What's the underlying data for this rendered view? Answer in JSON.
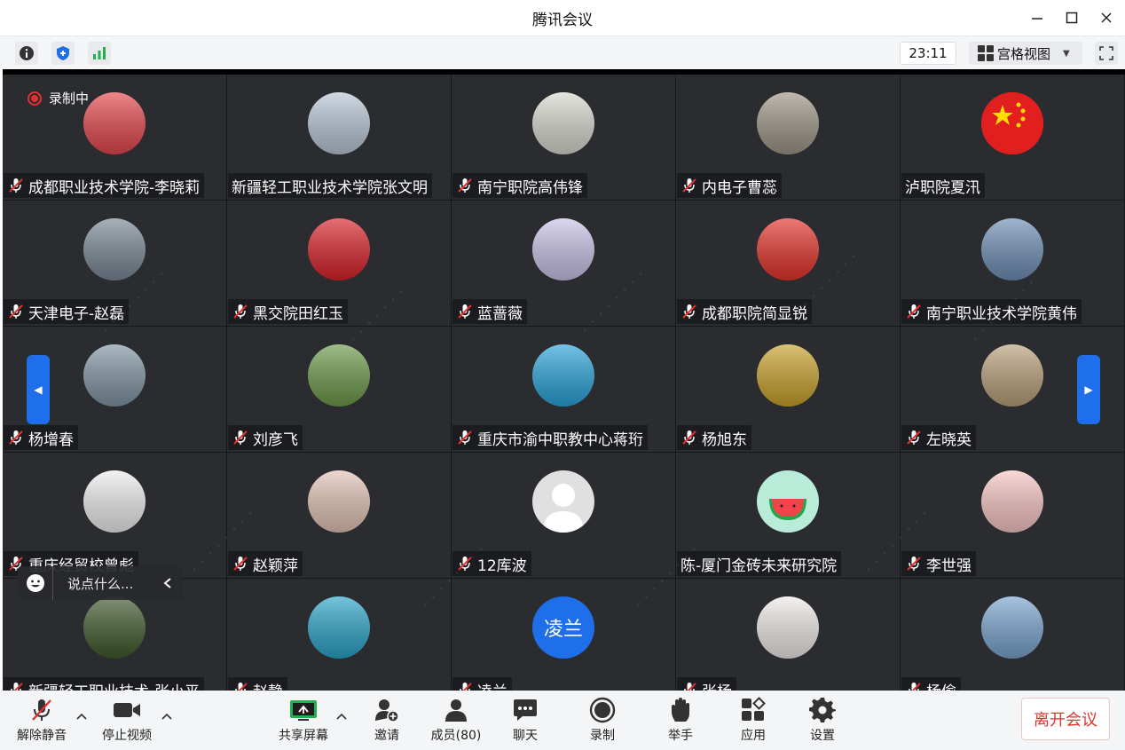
{
  "window": {
    "title": "腾讯会议"
  },
  "toolbar": {
    "timer": "23:11",
    "view_label": "宫格视图"
  },
  "recording": {
    "label": "录制中"
  },
  "chat": {
    "placeholder": "说点什么..."
  },
  "participants": [
    {
      "name": "成都职业技术学院-李晓莉",
      "muted": true,
      "avatar": "rose",
      "color": "#e4474d"
    },
    {
      "name": "新疆轻工职业技术学院张文明",
      "muted": false,
      "avatar": "snow-person",
      "color": "#b9c6d6"
    },
    {
      "name": "南宁职院高伟锋",
      "muted": true,
      "avatar": "cartoon-man",
      "color": "#d8d8d0"
    },
    {
      "name": "内电子曹蕊",
      "muted": true,
      "avatar": "woman-photo",
      "color": "#9e9588"
    },
    {
      "name": "泸职院夏汛",
      "muted": false,
      "avatar": "china-flag",
      "color": "#e21f1f"
    },
    {
      "name": "天津电子-赵磊",
      "muted": true,
      "avatar": "cars",
      "color": "#7b8895"
    },
    {
      "name": "黑交院田红玉",
      "muted": true,
      "avatar": "man-suit-red",
      "color": "#d9232b"
    },
    {
      "name": "蓝蔷薇",
      "muted": true,
      "avatar": "winter-trees",
      "color": "#c9c3e8"
    },
    {
      "name": "成都职院简显锐",
      "muted": true,
      "avatar": "cartoon-flag",
      "color": "#e5342b"
    },
    {
      "name": "南宁职业技术学院黄伟",
      "muted": true,
      "avatar": "tree-sky",
      "color": "#6e8fb5"
    },
    {
      "name": "杨增春",
      "muted": true,
      "avatar": "road-sky",
      "color": "#8095a3"
    },
    {
      "name": "刘彦飞",
      "muted": true,
      "avatar": "green-hill",
      "color": "#6d9a4a"
    },
    {
      "name": "重庆市渝中职教中心蒋珩",
      "muted": true,
      "avatar": "pool",
      "color": "#2aa3d9"
    },
    {
      "name": "杨旭东",
      "muted": true,
      "avatar": "autumn-tree",
      "color": "#c9a22c"
    },
    {
      "name": "左晓英",
      "muted": true,
      "avatar": "flowers",
      "color": "#b9a07a"
    },
    {
      "name": "重庆经贸校曾彪",
      "muted": true,
      "avatar": "ink-art",
      "color": "#eeeeee"
    },
    {
      "name": "赵颖萍",
      "muted": true,
      "avatar": "woman-hat",
      "color": "#e3c3b5"
    },
    {
      "name": "12库波",
      "muted": true,
      "avatar": "default",
      "color": "#e0e0e0"
    },
    {
      "name": "陈-厦门金砖未来研究院",
      "muted": false,
      "avatar": "watermelon",
      "color": "#b8ecd9"
    },
    {
      "name": "李世强",
      "muted": true,
      "avatar": "pink-face",
      "color": "#f7c6c4"
    },
    {
      "name": "新疆轻工职业技术-张小平",
      "muted": true,
      "avatar": "orchid",
      "color": "#3f5a2c"
    },
    {
      "name": "赵静",
      "muted": true,
      "avatar": "water-drop",
      "color": "#2ba4c8"
    },
    {
      "name": "凌兰",
      "muted": true,
      "avatar": "text",
      "avatar_text": "凌兰",
      "color": "#1f6feb"
    },
    {
      "name": "张杨",
      "muted": true,
      "avatar": "girl-drawing",
      "color": "#eeeae8"
    },
    {
      "name": "杨偷",
      "muted": true,
      "avatar": "mountain",
      "color": "#7aa4cf"
    }
  ],
  "bottom": {
    "unmute": "解除静音",
    "stop_video": "停止视频",
    "share": "共享屏幕",
    "invite": "邀请",
    "members": "成员(80)",
    "chat": "聊天",
    "record": "录制",
    "raise_hand": "举手",
    "apps": "应用",
    "settings": "设置",
    "leave": "离开会议"
  },
  "colors": {
    "accent": "#1f6feb",
    "danger": "#e0312f",
    "tile": "#2b2c30"
  }
}
